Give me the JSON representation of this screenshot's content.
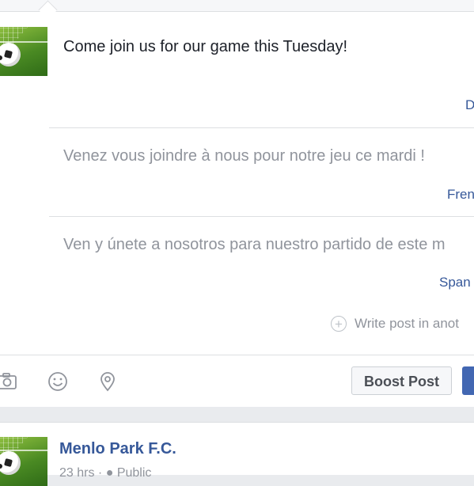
{
  "composer": {
    "post_text": "Come join us for our game this Tuesday!",
    "default_language_label": "D",
    "translations": [
      {
        "text": "Venez vous joindre à nous pour notre jeu ce mardi !",
        "language": "Fren"
      },
      {
        "text": "Ven y únete a nosotros para nuestro partido de este m",
        "language": "Span"
      }
    ],
    "add_language_text": "Write post in anot",
    "toolbar": {
      "icons": [
        "camera-icon",
        "emoji-icon",
        "location-pin-icon"
      ],
      "boost_label": "Boost Post"
    }
  },
  "feed_post": {
    "page_name": "Menlo Park F.C.",
    "time": "23 hrs",
    "separator": "·",
    "privacy": "Public"
  },
  "colors": {
    "link_blue": "#365899",
    "primary_button": "#4267b2",
    "muted_text": "#90949c",
    "background": "#e9ebee"
  }
}
